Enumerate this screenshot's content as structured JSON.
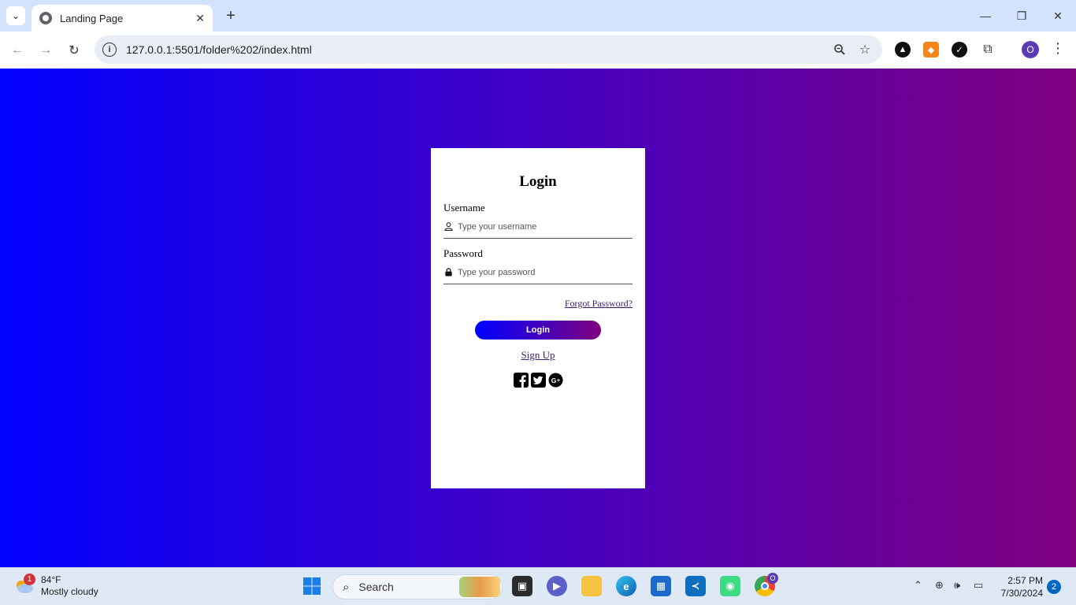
{
  "browser": {
    "tab_title": "Landing Page",
    "url": "127.0.0.1:5501/folder%202/index.html",
    "profile_initial": "O"
  },
  "page": {
    "heading": "Login",
    "username_label": "Username",
    "username_placeholder": "Type your username",
    "password_label": "Password",
    "password_placeholder": "Type your password",
    "forgot_link": "Forgot Password?",
    "login_button": "Login",
    "signup_link": "Sign Up",
    "social_icons": [
      "facebook-icon",
      "twitter-icon",
      "google-plus-icon"
    ],
    "gradient": [
      "#0000ff",
      "#800080"
    ]
  },
  "taskbar": {
    "weather_temp": "84°F",
    "weather_desc": "Mostly cloudy",
    "weather_badge": "1",
    "search_label": "Search",
    "chrome_badge": "O",
    "time": "2:57 PM",
    "date": "7/30/2024",
    "notification_count": "2"
  }
}
